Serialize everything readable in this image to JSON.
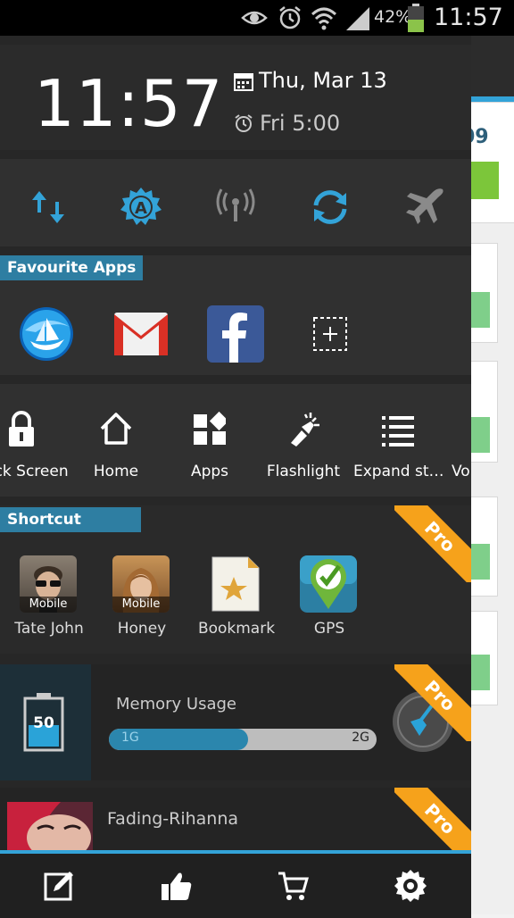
{
  "status_bar": {
    "icons": [
      "eye-icon",
      "alarm-icon",
      "wifi-icon",
      "signal-icon",
      "battery-icon"
    ],
    "battery_percent": "42%",
    "time": "11:57"
  },
  "clock_section": {
    "time": "11:57",
    "date": "Thu, Mar 13",
    "next_alarm": "Fri 5:00"
  },
  "toggles": [
    {
      "name": "mobile-data-toggle",
      "icon": "data-arrows-icon",
      "color": "#33a3d8"
    },
    {
      "name": "auto-brightness-toggle",
      "icon": "auto-brightness-icon",
      "color": "#33a3d8"
    },
    {
      "name": "hotspot-toggle",
      "icon": "hotspot-icon",
      "color": "#8a8a8a"
    },
    {
      "name": "auto-sync-toggle",
      "icon": "sync-icon",
      "color": "#33a3d8"
    },
    {
      "name": "airplane-mode-toggle",
      "icon": "airplane-icon",
      "color": "#8a8a8a"
    }
  ],
  "favourite_apps": {
    "title": "Favourite Apps",
    "apps": [
      {
        "icon": "boat-browser-icon"
      },
      {
        "icon": "gmail-icon"
      },
      {
        "icon": "facebook-icon"
      },
      {
        "icon": "add-app-icon"
      }
    ]
  },
  "quick_actions": [
    {
      "label": "Lock Screen",
      "icon": "lock-icon"
    },
    {
      "label": "Home",
      "icon": "home-icon"
    },
    {
      "label": "Apps",
      "icon": "apps-icon"
    },
    {
      "label": "Flashlight",
      "icon": "flashlight-icon"
    },
    {
      "label": "Expand st…",
      "icon": "list-icon"
    },
    {
      "label": "Vo",
      "icon": "volume-icon"
    }
  ],
  "shortcut": {
    "title": "Shortcut",
    "pro_label": "Pro",
    "items": [
      {
        "label": "Tate John",
        "badge": "Mobile",
        "icon": "contact-avatar-icon"
      },
      {
        "label": "Honey",
        "badge": "Mobile",
        "icon": "contact-avatar-icon"
      },
      {
        "label": "Bookmark",
        "icon": "bookmark-icon"
      },
      {
        "label": "GPS",
        "icon": "gps-icon"
      }
    ]
  },
  "memory": {
    "title": "Memory Usage",
    "battery_level": "50",
    "used_label": "1G",
    "total_label": "2G",
    "used_fraction": 0.52,
    "pro_label": "Pro"
  },
  "music": {
    "track": "Fading-Rihanna",
    "pro_label": "Pro"
  },
  "bottom_bar": [
    "edit-icon",
    "like-icon",
    "cart-icon",
    "settings-icon"
  ],
  "colors": {
    "accent": "#33a3d8",
    "section_title_bg": "#2e7ea2",
    "pro": "#f6a21b"
  },
  "background_app": {
    "partial_number": "09"
  }
}
